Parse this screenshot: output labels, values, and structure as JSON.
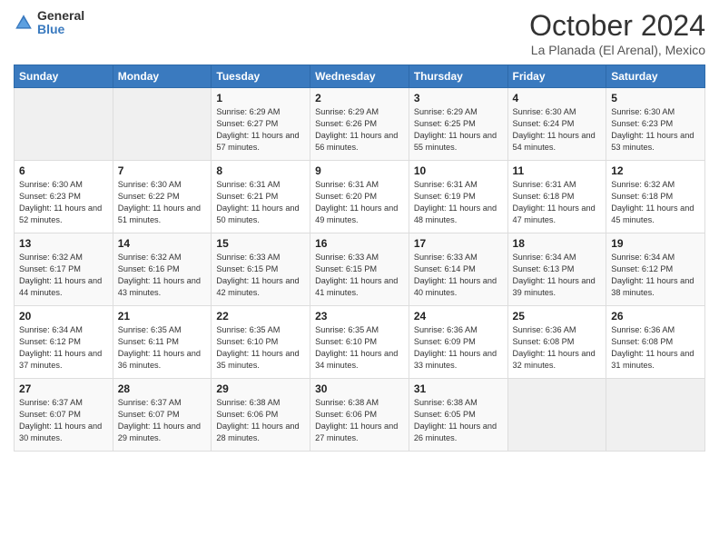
{
  "logo": {
    "general": "General",
    "blue": "Blue"
  },
  "header": {
    "month": "October 2024",
    "location": "La Planada (El Arenal), Mexico"
  },
  "weekdays": [
    "Sunday",
    "Monday",
    "Tuesday",
    "Wednesday",
    "Thursday",
    "Friday",
    "Saturday"
  ],
  "weeks": [
    [
      {
        "day": "",
        "info": ""
      },
      {
        "day": "",
        "info": ""
      },
      {
        "day": "1",
        "info": "Sunrise: 6:29 AM\nSunset: 6:27 PM\nDaylight: 11 hours and 57 minutes."
      },
      {
        "day": "2",
        "info": "Sunrise: 6:29 AM\nSunset: 6:26 PM\nDaylight: 11 hours and 56 minutes."
      },
      {
        "day": "3",
        "info": "Sunrise: 6:29 AM\nSunset: 6:25 PM\nDaylight: 11 hours and 55 minutes."
      },
      {
        "day": "4",
        "info": "Sunrise: 6:30 AM\nSunset: 6:24 PM\nDaylight: 11 hours and 54 minutes."
      },
      {
        "day": "5",
        "info": "Sunrise: 6:30 AM\nSunset: 6:23 PM\nDaylight: 11 hours and 53 minutes."
      }
    ],
    [
      {
        "day": "6",
        "info": "Sunrise: 6:30 AM\nSunset: 6:23 PM\nDaylight: 11 hours and 52 minutes."
      },
      {
        "day": "7",
        "info": "Sunrise: 6:30 AM\nSunset: 6:22 PM\nDaylight: 11 hours and 51 minutes."
      },
      {
        "day": "8",
        "info": "Sunrise: 6:31 AM\nSunset: 6:21 PM\nDaylight: 11 hours and 50 minutes."
      },
      {
        "day": "9",
        "info": "Sunrise: 6:31 AM\nSunset: 6:20 PM\nDaylight: 11 hours and 49 minutes."
      },
      {
        "day": "10",
        "info": "Sunrise: 6:31 AM\nSunset: 6:19 PM\nDaylight: 11 hours and 48 minutes."
      },
      {
        "day": "11",
        "info": "Sunrise: 6:31 AM\nSunset: 6:18 PM\nDaylight: 11 hours and 47 minutes."
      },
      {
        "day": "12",
        "info": "Sunrise: 6:32 AM\nSunset: 6:18 PM\nDaylight: 11 hours and 45 minutes."
      }
    ],
    [
      {
        "day": "13",
        "info": "Sunrise: 6:32 AM\nSunset: 6:17 PM\nDaylight: 11 hours and 44 minutes."
      },
      {
        "day": "14",
        "info": "Sunrise: 6:32 AM\nSunset: 6:16 PM\nDaylight: 11 hours and 43 minutes."
      },
      {
        "day": "15",
        "info": "Sunrise: 6:33 AM\nSunset: 6:15 PM\nDaylight: 11 hours and 42 minutes."
      },
      {
        "day": "16",
        "info": "Sunrise: 6:33 AM\nSunset: 6:15 PM\nDaylight: 11 hours and 41 minutes."
      },
      {
        "day": "17",
        "info": "Sunrise: 6:33 AM\nSunset: 6:14 PM\nDaylight: 11 hours and 40 minutes."
      },
      {
        "day": "18",
        "info": "Sunrise: 6:34 AM\nSunset: 6:13 PM\nDaylight: 11 hours and 39 minutes."
      },
      {
        "day": "19",
        "info": "Sunrise: 6:34 AM\nSunset: 6:12 PM\nDaylight: 11 hours and 38 minutes."
      }
    ],
    [
      {
        "day": "20",
        "info": "Sunrise: 6:34 AM\nSunset: 6:12 PM\nDaylight: 11 hours and 37 minutes."
      },
      {
        "day": "21",
        "info": "Sunrise: 6:35 AM\nSunset: 6:11 PM\nDaylight: 11 hours and 36 minutes."
      },
      {
        "day": "22",
        "info": "Sunrise: 6:35 AM\nSunset: 6:10 PM\nDaylight: 11 hours and 35 minutes."
      },
      {
        "day": "23",
        "info": "Sunrise: 6:35 AM\nSunset: 6:10 PM\nDaylight: 11 hours and 34 minutes."
      },
      {
        "day": "24",
        "info": "Sunrise: 6:36 AM\nSunset: 6:09 PM\nDaylight: 11 hours and 33 minutes."
      },
      {
        "day": "25",
        "info": "Sunrise: 6:36 AM\nSunset: 6:08 PM\nDaylight: 11 hours and 32 minutes."
      },
      {
        "day": "26",
        "info": "Sunrise: 6:36 AM\nSunset: 6:08 PM\nDaylight: 11 hours and 31 minutes."
      }
    ],
    [
      {
        "day": "27",
        "info": "Sunrise: 6:37 AM\nSunset: 6:07 PM\nDaylight: 11 hours and 30 minutes."
      },
      {
        "day": "28",
        "info": "Sunrise: 6:37 AM\nSunset: 6:07 PM\nDaylight: 11 hours and 29 minutes."
      },
      {
        "day": "29",
        "info": "Sunrise: 6:38 AM\nSunset: 6:06 PM\nDaylight: 11 hours and 28 minutes."
      },
      {
        "day": "30",
        "info": "Sunrise: 6:38 AM\nSunset: 6:06 PM\nDaylight: 11 hours and 27 minutes."
      },
      {
        "day": "31",
        "info": "Sunrise: 6:38 AM\nSunset: 6:05 PM\nDaylight: 11 hours and 26 minutes."
      },
      {
        "day": "",
        "info": ""
      },
      {
        "day": "",
        "info": ""
      }
    ]
  ]
}
